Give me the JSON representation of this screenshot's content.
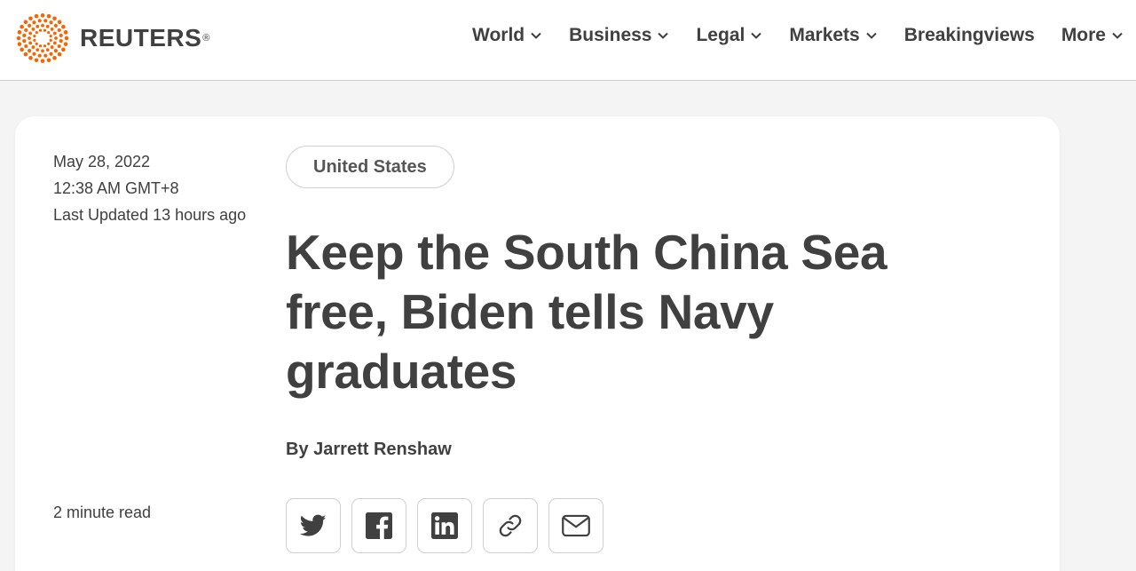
{
  "brand": {
    "name": "REUTERS",
    "registered_mark": "®",
    "accent": "#fa6400"
  },
  "nav": {
    "items": [
      {
        "label": "World",
        "has_dropdown": true
      },
      {
        "label": "Business",
        "has_dropdown": true
      },
      {
        "label": "Legal",
        "has_dropdown": true
      },
      {
        "label": "Markets",
        "has_dropdown": true
      },
      {
        "label": "Breakingviews",
        "has_dropdown": false
      },
      {
        "label": "More",
        "has_dropdown": true
      }
    ]
  },
  "article": {
    "date": "May 28, 2022",
    "time": "12:38 AM GMT+8",
    "last_updated": "Last Updated 13 hours ago",
    "read_time": "2 minute read",
    "tag": "United States",
    "headline": "Keep the South China Sea free, Biden tells Navy graduates",
    "byline_prefix": "By",
    "author": "Jarrett Renshaw"
  },
  "share": {
    "buttons": [
      {
        "icon": "twitter-icon"
      },
      {
        "icon": "facebook-icon"
      },
      {
        "icon": "linkedin-icon"
      },
      {
        "icon": "link-icon"
      },
      {
        "icon": "email-icon"
      }
    ]
  },
  "colors": {
    "text": "#404040",
    "page_bg": "#f4f4f4",
    "card_bg": "#ffffff",
    "border": "#cfcfcf"
  }
}
